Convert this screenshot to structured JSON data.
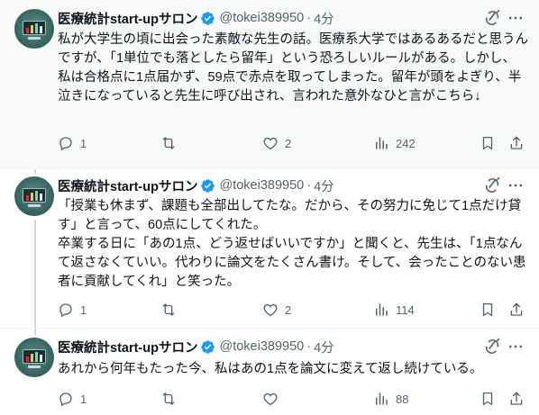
{
  "colors": {
    "text": "#0f1419",
    "muted": "#536471",
    "verified": "#1d9bf0",
    "thread_line": "#cfd9de",
    "highlight_bg": "#f7f9f9"
  },
  "tweets": [
    {
      "author": "医療統計start-upサロン",
      "handle": "@tokei389950",
      "separator": "·",
      "time": "4分",
      "text": "私が大学生の頃に出会った素敵な先生の話。医療系大学ではあるあるだと思うんですが、「1単位でも落としたら留年」という恐ろしいルールがある。しかし、私は合格点に1点届かず、59点で赤点を取ってしまった。留年が頭をよぎり、半泣きになっていると先生に呼び出され、言われた意外なひと言がこちら↓",
      "replies": "1",
      "retweets": "",
      "likes": "2",
      "views": "242",
      "icons": [
        "avatar",
        "verified-badge-icon",
        "grok-icon",
        "more-icon",
        "reply-icon",
        "retweet-icon",
        "like-icon",
        "views-icon",
        "bookmark-icon",
        "share-icon"
      ]
    },
    {
      "author": "医療統計start-upサロン",
      "handle": "@tokei389950",
      "separator": "·",
      "time": "4分",
      "text": "「授業も休まず、課題も全部出してたな。だから、その努力に免じて1点だけ貸す」と言って、60点にしてくれた。\n卒業する日に「あの1点、どう返せばいいですか」と聞くと、先生は、「1点なんて返さなくていい。代わりに論文をたくさん書け。そして、会ったことのない患者に貢献してくれ」と笑った。",
      "replies": "1",
      "retweets": "",
      "likes": "2",
      "views": "114"
    },
    {
      "author": "医療統計start-upサロン",
      "handle": "@tokei389950",
      "separator": "·",
      "time": "4分",
      "text": "あれから何年もたった今、私はあの1点を論文に変えて返し続けている。",
      "replies": "1",
      "retweets": "",
      "likes": "",
      "views": "88"
    }
  ]
}
